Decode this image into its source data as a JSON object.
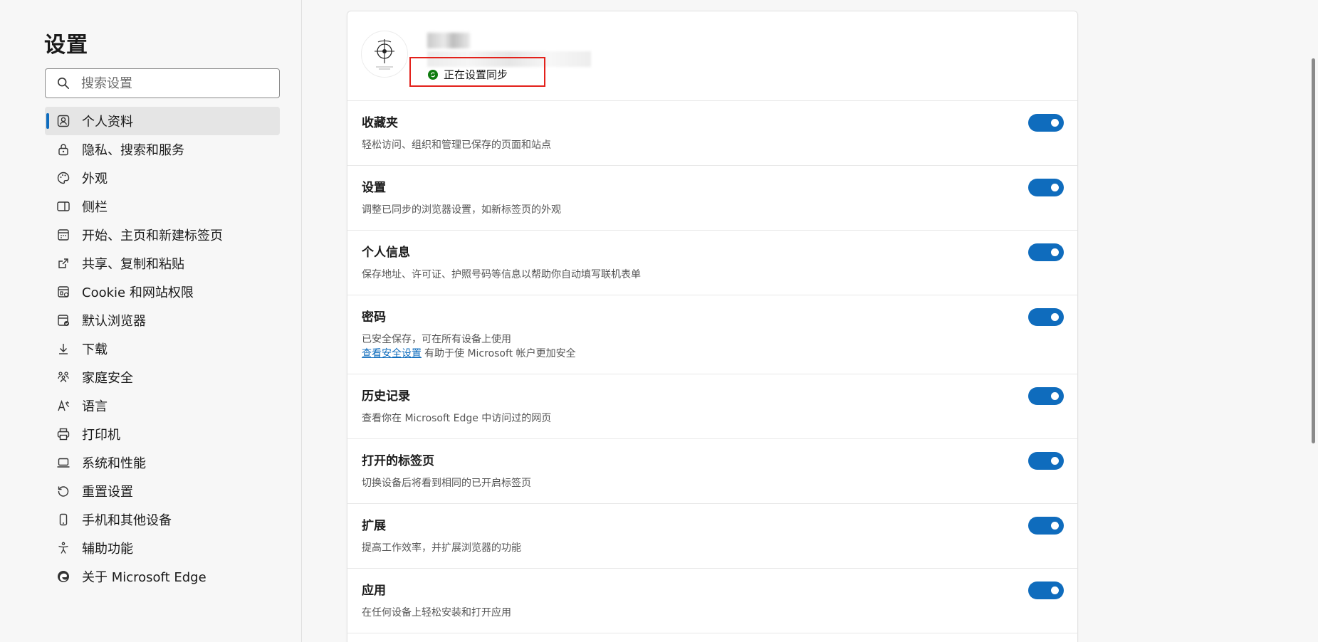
{
  "sidebar": {
    "title": "设置",
    "search": {
      "placeholder": "搜索设置",
      "value": ""
    },
    "items": [
      {
        "label": "个人资料",
        "icon": "profile-icon",
        "active": true
      },
      {
        "label": "隐私、搜索和服务",
        "icon": "lock-icon"
      },
      {
        "label": "外观",
        "icon": "palette-icon"
      },
      {
        "label": "侧栏",
        "icon": "sidebar-icon"
      },
      {
        "label": "开始、主页和新建标签页",
        "icon": "home-grid-icon"
      },
      {
        "label": "共享、复制和粘贴",
        "icon": "share-icon"
      },
      {
        "label": "Cookie 和网站权限",
        "icon": "site-permissions-icon"
      },
      {
        "label": "默认浏览器",
        "icon": "default-browser-icon"
      },
      {
        "label": "下载",
        "icon": "download-icon"
      },
      {
        "label": "家庭安全",
        "icon": "family-icon"
      },
      {
        "label": "语言",
        "icon": "language-icon"
      },
      {
        "label": "打印机",
        "icon": "printer-icon"
      },
      {
        "label": "系统和性能",
        "icon": "laptop-icon"
      },
      {
        "label": "重置设置",
        "icon": "reset-icon"
      },
      {
        "label": "手机和其他设备",
        "icon": "phone-icon"
      },
      {
        "label": "辅助功能",
        "icon": "accessibility-icon"
      },
      {
        "label": "关于 Microsoft Edge",
        "icon": "edge-logo-icon"
      }
    ]
  },
  "profile": {
    "sync_status": "正在设置同步"
  },
  "sync_items": [
    {
      "title": "收藏夹",
      "desc": "轻松访问、组织和管理已保存的页面和站点",
      "enabled": true
    },
    {
      "title": "设置",
      "desc": "调整已同步的浏览器设置，如新标签页的外观",
      "enabled": true
    },
    {
      "title": "个人信息",
      "desc": "保存地址、许可证、护照号码等信息以帮助你自动填写联机表单",
      "enabled": true
    },
    {
      "title": "密码",
      "desc": "已安全保存，可在所有设备上使用",
      "link": "查看安全设置",
      "desc_after_link": "有助于使 Microsoft 帐户更加安全",
      "enabled": true
    },
    {
      "title": "历史记录",
      "desc": "查看你在 Microsoft Edge 中访问过的网页",
      "enabled": true
    },
    {
      "title": "打开的标签页",
      "desc": "切换设备后将看到相同的已开启标签页",
      "enabled": true
    },
    {
      "title": "扩展",
      "desc": "提高工作效率，并扩展浏览器的功能",
      "enabled": true
    },
    {
      "title": "应用",
      "desc": "在任何设备上轻松安装和打开应用",
      "enabled": true
    }
  ],
  "colors": {
    "accent": "#0f6cbd",
    "sync_ok": "#107c10",
    "highlight_box": "#e3211b"
  }
}
